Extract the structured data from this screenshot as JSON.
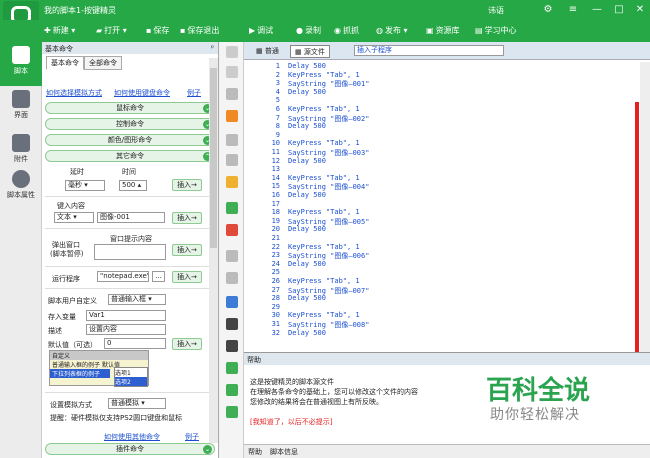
{
  "window": {
    "title": "我的脚本1-按键精灵",
    "user": "讳语",
    "controls": [
      "⚙",
      "≡",
      "—",
      "□",
      "✕"
    ]
  },
  "toolbar": [
    "新建",
    "打开",
    "保存",
    "保存退出",
    "调试",
    "录制",
    "抓抓",
    "发布",
    "资源库",
    "学习中心"
  ],
  "nav": [
    {
      "label": "脚本",
      "icon": "script-icon"
    },
    {
      "label": "界面",
      "icon": "interface-icon"
    },
    {
      "label": "附件",
      "icon": "attachment-icon"
    },
    {
      "label": "脚本属性",
      "icon": "info-icon"
    }
  ],
  "panel": {
    "title": "基本命令",
    "tabs": [
      "基本命令",
      "全部命令"
    ],
    "link1": "如何选择模拟方式",
    "link2": "如何使用键盘命令",
    "link3": "例子",
    "groups": [
      "鼠标命令",
      "控制命令",
      "颜色/图形命令",
      "其它命令"
    ],
    "delay_label": "延时",
    "time_label": "时间",
    "delay_unit": "毫秒",
    "delay_value": "500",
    "insert": "插入→",
    "key_content": "键入内容",
    "text_type": "文本",
    "text_value": "图像-001",
    "popup_label1": "弹出窗口",
    "popup_label2": "(脚本暂停)",
    "popup_content": "窗口提示内容",
    "run_label": "运行程序",
    "run_value": "\"notepad.exe\"",
    "browse": "...",
    "custom_label": "脚本用户自定义",
    "custom_mode": "普通输入框",
    "store_label": "存入变量",
    "store_value": "Var1",
    "desc_label": "描述",
    "desc_value": "设置内容",
    "default_label": "默认值（可选）",
    "default_value": "0",
    "dropdown": {
      "title": "自定义",
      "rows": [
        "普通输入框的例子",
        "下拉列表框的例子"
      ],
      "col": "默认值",
      "opts": [
        "选项1",
        "选项2"
      ]
    },
    "sim_label": "设置模拟方式",
    "sim_value": "普通模拟",
    "tip": "提醒：硬件模拟仅支持PS2圆口键盘和鼠标",
    "link4": "如何使用其他命令",
    "link5": "例子",
    "plugin": "插件命令"
  },
  "editor": {
    "tabs": [
      "普通",
      "源文件"
    ],
    "combo": "插入子程序",
    "lines": [
      {
        "n": "1",
        "t": "Delay 500"
      },
      {
        "n": "2",
        "t": "KeyPress \"Tab\", 1"
      },
      {
        "n": "3",
        "t": "SayString \"图像—001\""
      },
      {
        "n": "4",
        "t": "Delay 500"
      },
      {
        "n": "5",
        "t": ""
      },
      {
        "n": "6",
        "t": "KeyPress \"Tab\", 1"
      },
      {
        "n": "7",
        "t": "SayString \"图像—002\""
      },
      {
        "n": "8",
        "t": "Delay 500"
      },
      {
        "n": "9",
        "t": ""
      },
      {
        "n": "10",
        "t": "KeyPress \"Tab\", 1"
      },
      {
        "n": "11",
        "t": "SayString \"图像—003\""
      },
      {
        "n": "12",
        "t": "Delay 500"
      },
      {
        "n": "13",
        "t": ""
      },
      {
        "n": "14",
        "t": "KeyPress \"Tab\", 1"
      },
      {
        "n": "15",
        "t": "SayString \"图像—004\""
      },
      {
        "n": "16",
        "t": "Delay 500"
      },
      {
        "n": "17",
        "t": ""
      },
      {
        "n": "18",
        "t": "KeyPress \"Tab\", 1"
      },
      {
        "n": "19",
        "t": "SayString \"图像—005\""
      },
      {
        "n": "20",
        "t": "Delay 500"
      },
      {
        "n": "21",
        "t": ""
      },
      {
        "n": "22",
        "t": "KeyPress \"Tab\", 1"
      },
      {
        "n": "23",
        "t": "SayString \"图像—006\""
      },
      {
        "n": "24",
        "t": "Delay 500"
      },
      {
        "n": "25",
        "t": ""
      },
      {
        "n": "26",
        "t": "KeyPress \"Tab\", 1"
      },
      {
        "n": "27",
        "t": "SayString \"图像—007\""
      },
      {
        "n": "28",
        "t": "Delay 500"
      },
      {
        "n": "29",
        "t": ""
      },
      {
        "n": "30",
        "t": "KeyPress \"Tab\", 1"
      },
      {
        "n": "31",
        "t": "SayString \"图像—008\""
      },
      {
        "n": "32",
        "t": "Delay 500"
      }
    ]
  },
  "help": {
    "title": "帮助",
    "line1": "这是按键精灵的脚本源文件",
    "line2": "在理解各条命令的基础上，您可以修改这个文件的内容",
    "line3": "您修改的结果将会在普通视图上有所反映。",
    "line4": "[我知道了，以后不必提示]",
    "tabs": [
      "帮助",
      "脚本信息"
    ]
  },
  "watermark": {
    "big": "百科全说",
    "small": "助你轻松解决"
  }
}
